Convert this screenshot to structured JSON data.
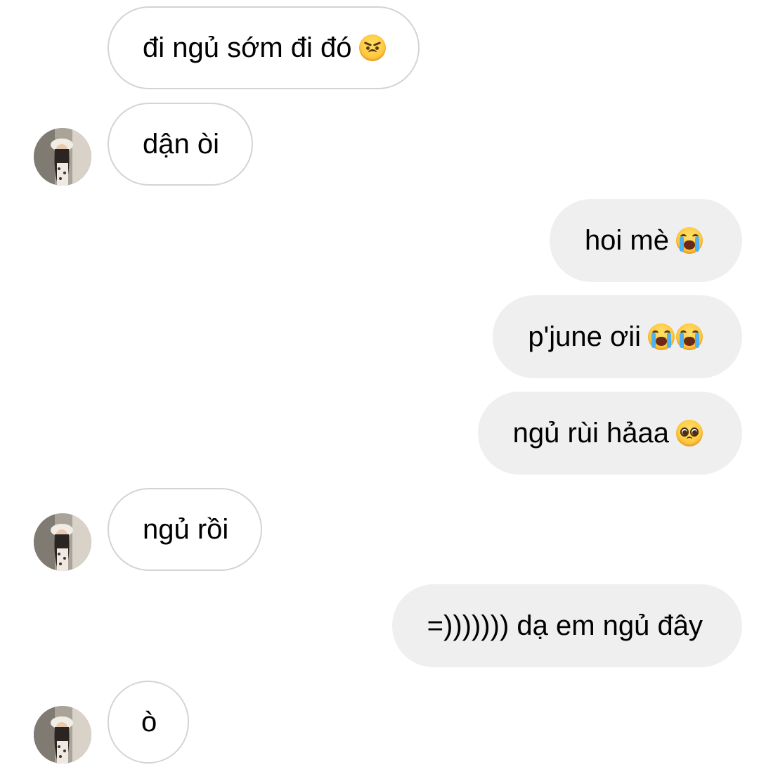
{
  "messages": [
    {
      "from": "other",
      "text": "đi ngủ sớm đi đó",
      "emoji": [
        "angry-face"
      ],
      "avatar": false
    },
    {
      "from": "other",
      "text": "dận òi",
      "emoji": [],
      "avatar": true
    },
    {
      "from": "me",
      "text": "hoi mè",
      "emoji": [
        "loudly-crying-face"
      ]
    },
    {
      "from": "me",
      "text": "p'june ơii",
      "emoji": [
        "loudly-crying-face",
        "loudly-crying-face"
      ]
    },
    {
      "from": "me",
      "text": "ngủ rùi hảaa",
      "emoji": [
        "pleading-face"
      ]
    },
    {
      "from": "other",
      "text": "ngủ rồi",
      "emoji": [],
      "avatar": true
    },
    {
      "from": "me",
      "text": "=))))))) dạ em ngủ đây",
      "emoji": []
    },
    {
      "from": "other",
      "text": "ò",
      "emoji": [],
      "avatar": true
    }
  ],
  "colors": {
    "background": "#ffffff",
    "sent_bubble": "#efefef",
    "received_border": "#d4d4d4",
    "text": "#000000"
  }
}
